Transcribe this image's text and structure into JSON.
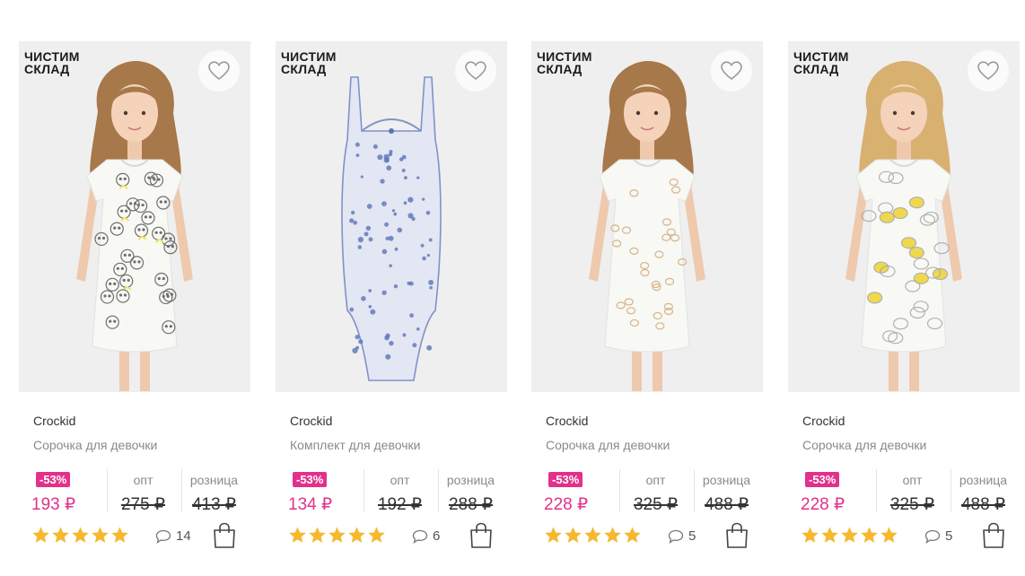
{
  "products": [
    {
      "promo_line1": "ЧИСТИМ",
      "promo_line2": "СКЛАД",
      "brand": "Crockid",
      "name": "Сорочка для девочки",
      "discount": "-53%",
      "price": "193 ₽",
      "opt_label": "опт",
      "opt_price": "275 ₽",
      "retail_label": "розница",
      "retail_price": "413 ₽",
      "rating": 5,
      "reviews": "14",
      "image": "girl-panda-nightdress",
      "print_color": "#6e6e6e",
      "accent": "#f2e35a"
    },
    {
      "promo_line1": "ЧИСТИМ",
      "promo_line2": "СКЛАД",
      "brand": "Crockid",
      "name": "Комплект для девочки",
      "discount": "-53%",
      "price": "134 ₽",
      "opt_label": "опт",
      "opt_price": "192 ₽",
      "retail_label": "розница",
      "retail_price": "288 ₽",
      "rating": 5,
      "reviews": "6",
      "image": "floral-bodysuit",
      "print_color": "#5b74b8",
      "accent": "#5b74b8"
    },
    {
      "promo_line1": "ЧИСТИМ",
      "promo_line2": "СКЛАД",
      "brand": "Crockid",
      "name": "Сорочка для девочки",
      "discount": "-53%",
      "price": "228 ₽",
      "opt_label": "опт",
      "opt_price": "325 ₽",
      "retail_label": "розница",
      "retail_price": "488 ₽",
      "rating": 5,
      "reviews": "5",
      "image": "girl-owl-nightdress",
      "print_color": "#d6b48a",
      "accent": "#e6c9a0"
    },
    {
      "promo_line1": "ЧИСТИМ",
      "promo_line2": "СКЛАД",
      "brand": "Crockid",
      "name": "Сорочка для девочки",
      "discount": "-53%",
      "price": "228 ₽",
      "opt_label": "опт",
      "opt_price": "325 ₽",
      "retail_label": "розница",
      "retail_price": "488 ₽",
      "rating": 5,
      "reviews": "5",
      "image": "girl-guinea-pig-nightdress",
      "print_color": "#a9a9a9",
      "accent": "#f0d53a"
    }
  ],
  "colors": {
    "accent_pink": "#e2318a",
    "star_yellow": "#f5b82e",
    "photo_bg": "#efefef"
  },
  "icons": {
    "favorite": "heart-outline-icon",
    "reviews": "speech-bubble-icon",
    "cart": "shopping-bag-icon",
    "rating": "star-icon"
  }
}
